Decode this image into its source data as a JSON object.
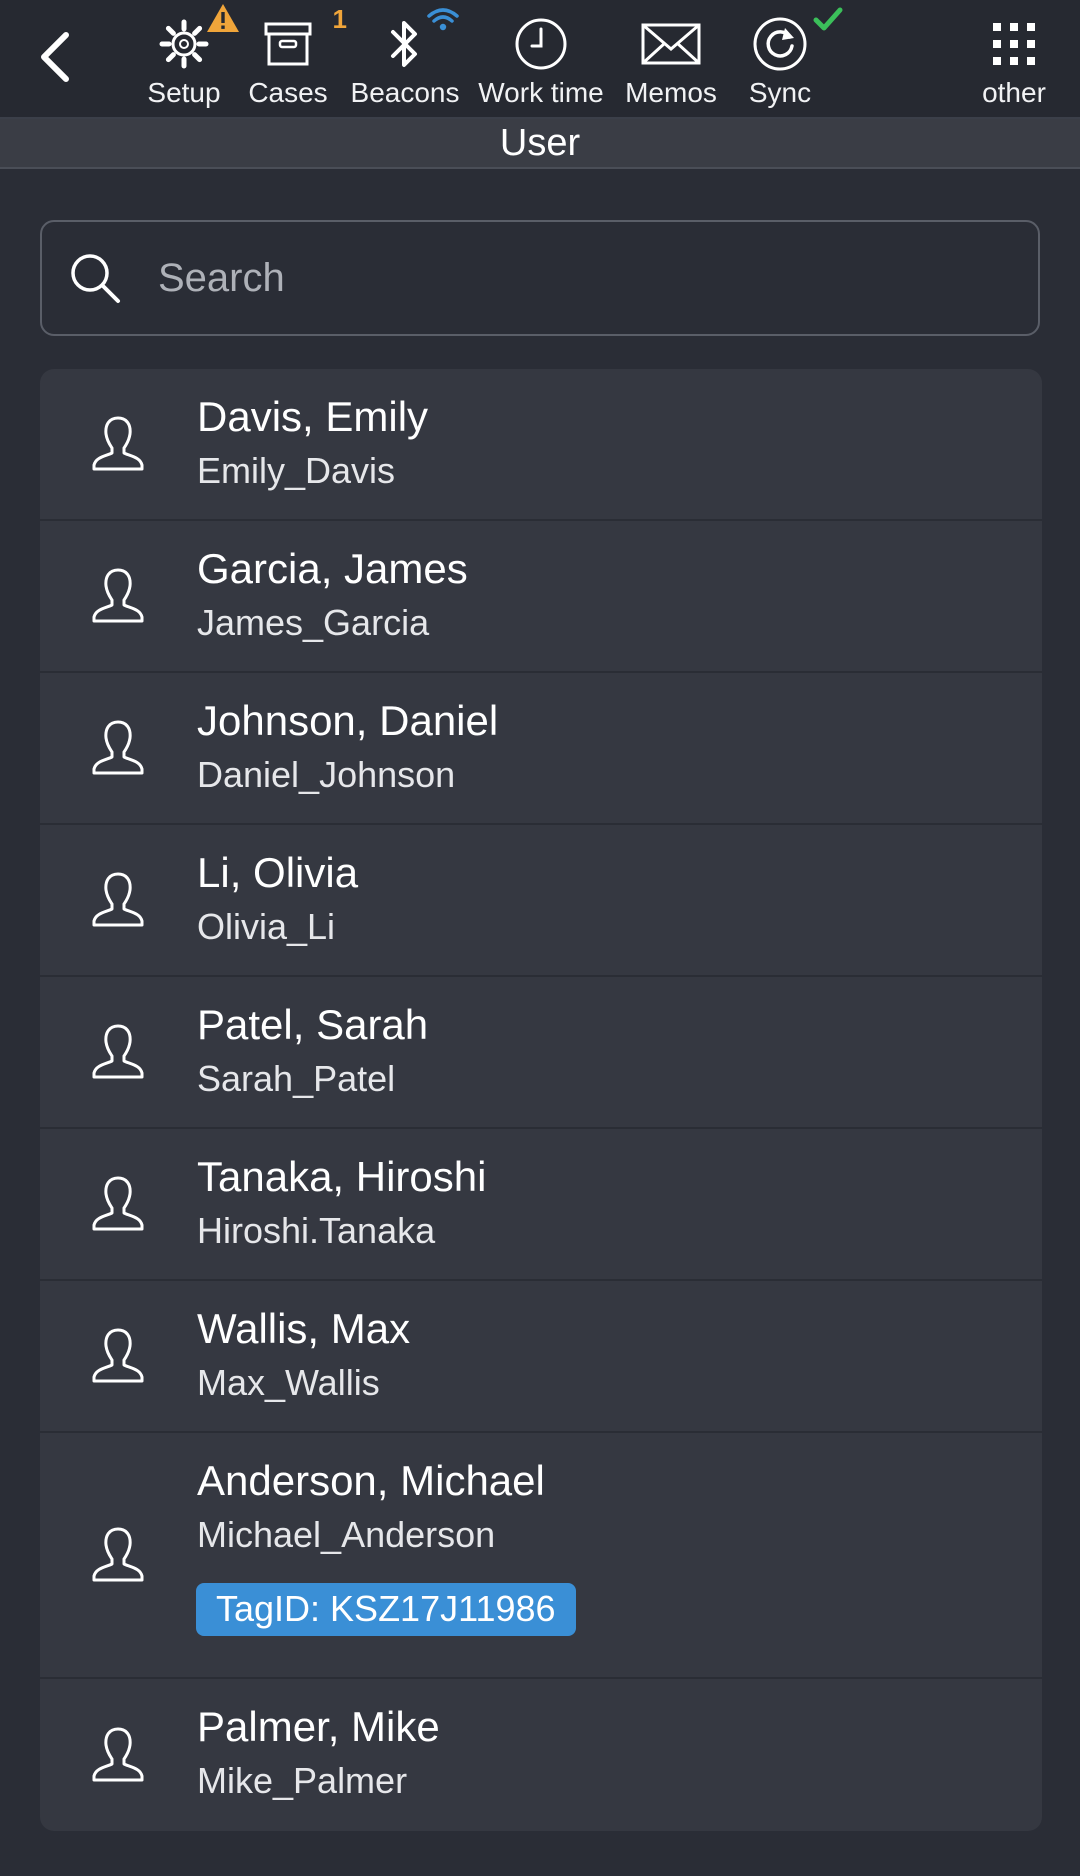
{
  "toolbar": {
    "back_icon": "chevron-left-icon",
    "items": [
      {
        "label": "Setup",
        "icon": "gear-icon",
        "badge_icon": "warning-icon",
        "badge_color": "#f0a53a"
      },
      {
        "label": "Cases",
        "icon": "archive-box-icon",
        "badge_count": "1",
        "badge_color": "#f0a53a"
      },
      {
        "label": "Beacons",
        "icon": "bluetooth-icon",
        "badge_icon": "wifi-icon",
        "badge_color": "#3a8fd6"
      },
      {
        "label": "Work time",
        "icon": "clock-icon"
      },
      {
        "label": "Memos",
        "icon": "envelope-icon"
      },
      {
        "label": "Sync",
        "icon": "sync-icon",
        "badge_icon": "checkmark-icon",
        "badge_color": "#3bbf5a"
      },
      {
        "label": "other",
        "icon": "grid-dots-icon"
      }
    ]
  },
  "page": {
    "title": "User"
  },
  "search": {
    "placeholder": "Search",
    "value": "",
    "icon": "search-icon"
  },
  "users": [
    {
      "name": "Davis, Emily",
      "username": "Emily_Davis"
    },
    {
      "name": "Garcia, James",
      "username": "James_Garcia"
    },
    {
      "name": "Johnson, Daniel",
      "username": "Daniel_Johnson"
    },
    {
      "name": "Li, Olivia",
      "username": "Olivia_Li"
    },
    {
      "name": "Patel, Sarah",
      "username": "Sarah_Patel"
    },
    {
      "name": "Tanaka, Hiroshi",
      "username": "Hiroshi.Tanaka"
    },
    {
      "name": "Wallis, Max",
      "username": "Max_Wallis"
    },
    {
      "name": "Anderson, Michael",
      "username": "Michael_Anderson",
      "tag": "TagID: KSZ17J11986"
    },
    {
      "name": "Palmer, Mike",
      "username": "Mike_Palmer"
    }
  ],
  "colors": {
    "background": "#2a2d36",
    "toolbar": "#262931",
    "list_row": "#353841",
    "tag_accent": "#3a8fd6",
    "warning": "#f0a53a",
    "success": "#3bbf5a"
  }
}
